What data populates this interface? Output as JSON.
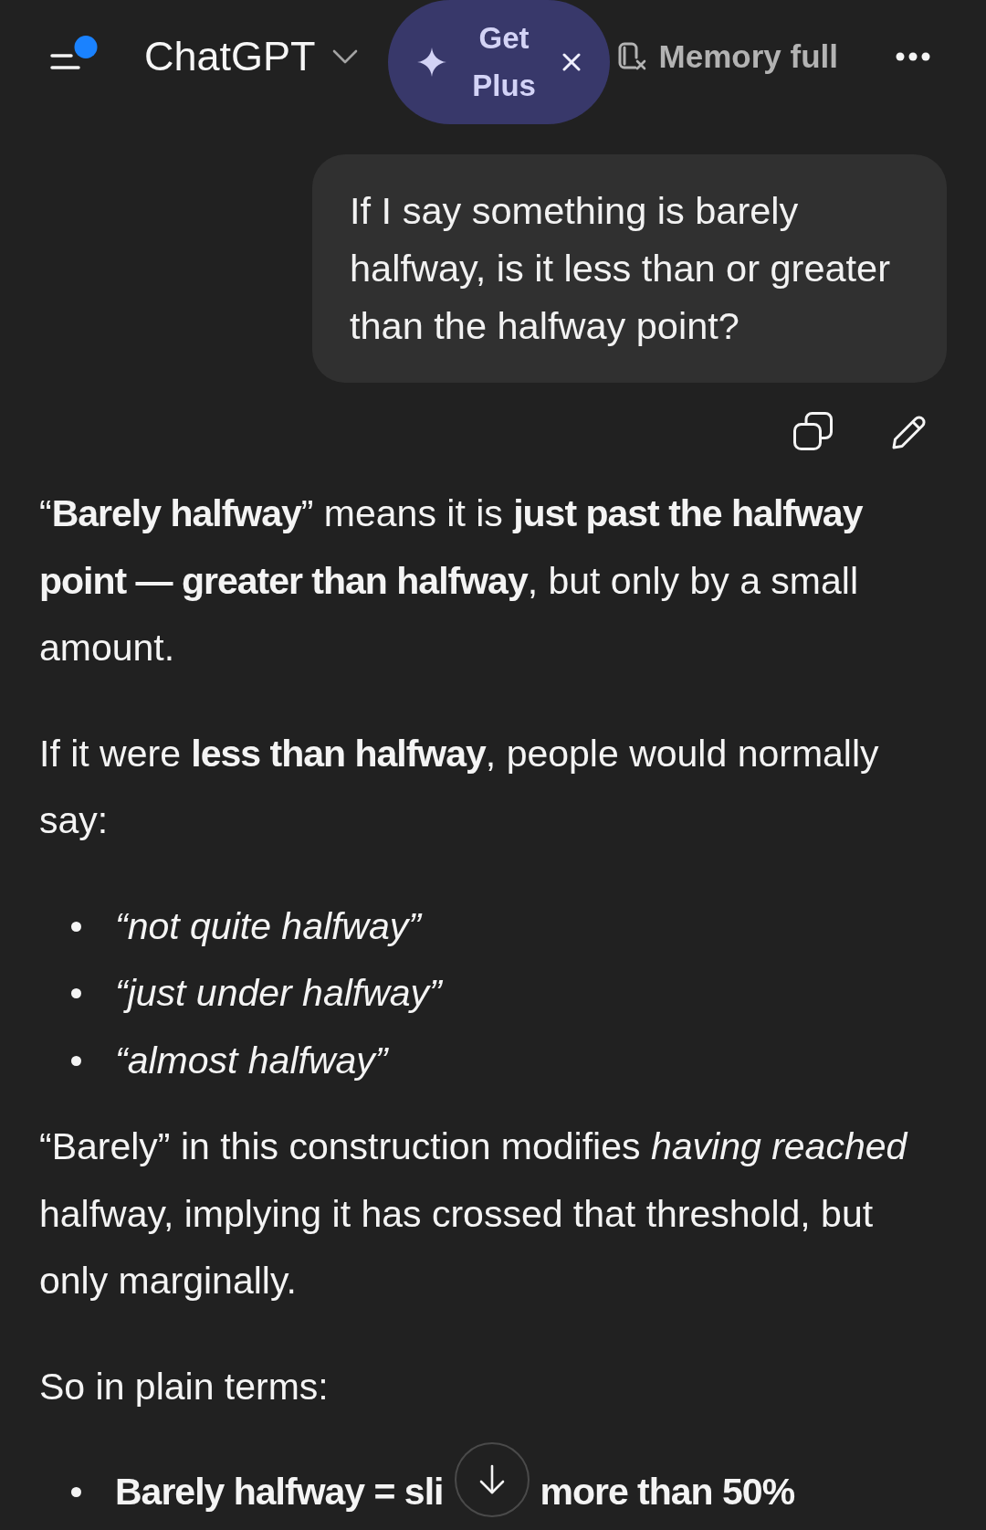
{
  "header": {
    "title": "ChatGPT",
    "promo": {
      "label": "Get Plus"
    },
    "memory": {
      "label": "Memory full"
    }
  },
  "user_message": {
    "text": "If I say something is barely halfway, is it less than or greater than the halfway point?"
  },
  "assistant_message": {
    "blocks": [
      {
        "kind": "paragraph",
        "text": "“**Barely halfway**” means it is **just past the halfway point — greater than halfway**, but only by a small amount."
      },
      {
        "kind": "paragraph",
        "text": "If it were **less than halfway**, people would normally say:"
      },
      {
        "kind": "list",
        "italic": true,
        "bold": false,
        "items": [
          {
            "parts": [
              "“not quite halfway”"
            ]
          },
          {
            "parts": [
              "“just under halfway”"
            ]
          },
          {
            "parts": [
              "“almost halfway”"
            ]
          }
        ]
      },
      {
        "kind": "paragraph",
        "text": "“Barely” in this construction modifies *having reached* halfway, implying it has crossed that threshold, but only marginally."
      },
      {
        "kind": "paragraph",
        "text": "So in plain terms:"
      },
      {
        "kind": "list",
        "italic": false,
        "bold": true,
        "items": [
          {
            "parts": [
              "Barely halfway = sli",
              "more than 50%"
            ]
          }
        ]
      }
    ]
  }
}
